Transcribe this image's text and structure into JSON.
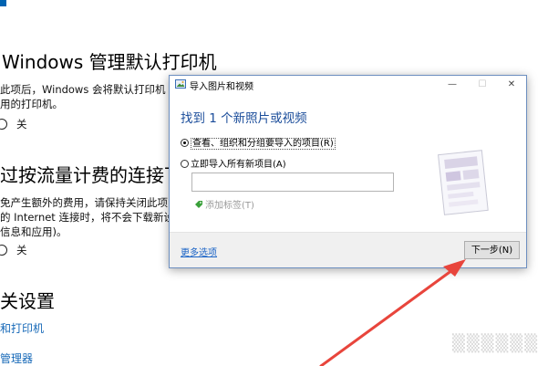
{
  "background": {
    "section1_title": "Windows 管理默认打印机",
    "section1_desc_line1": "此项后，Windows 会将默认打印机",
    "section1_desc_line2": "用的打印机。",
    "section1_toggle_label": "关",
    "section2_title": "过按流量计费的连接下",
    "section2_desc_line1": "免产生额外的费用，请保持关闭此项",
    "section2_desc_line2": "的 Internet 连接时，将不会下载新设",
    "section2_desc_line3": "信息和应用)。",
    "section2_toggle_label": "关",
    "related_title": "关设置",
    "link1": "和打印机",
    "link2": "管理器"
  },
  "dialog": {
    "title": "导入图片和视频",
    "window_buttons": {
      "minimize": "—",
      "maximize": "☐",
      "close": "✕"
    },
    "heading": "找到 1 个新照片或视频",
    "option1": "查看、组织和分组要导入的项目(R)",
    "option2": "立即导入所有新项目(A)",
    "tag_input_value": "",
    "add_tag": "添加标签(T)",
    "more_options": "更多选项",
    "next_button": "下一步(N)"
  },
  "colors": {
    "accent_blue": "#0063b1",
    "heading_blue": "#1a4c9a",
    "arrow_red": "#e8453c"
  },
  "icons": [
    "import-app-icon",
    "tag-icon",
    "photo-thumbnail-icon",
    "red-arrow"
  ]
}
